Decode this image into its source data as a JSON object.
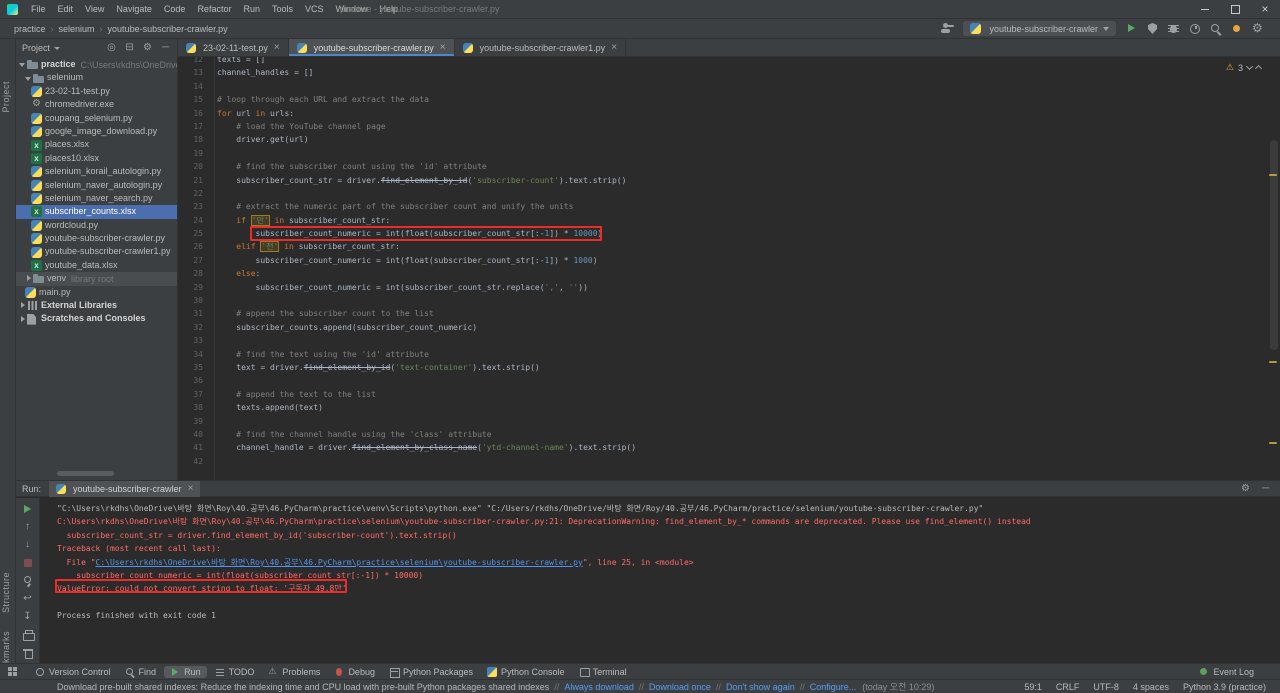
{
  "colors": {
    "panel_bg": "#3c3f41",
    "editor_bg": "#2b2b2b",
    "selection_blue": "#4b6eaf",
    "tab_accent": "#4a88c7",
    "run_green": "#59a869",
    "warning_yellow": "#f0a732",
    "error_red": "#ff6b68",
    "annotation_red": "#ee2b26",
    "link_blue": "#5394ec"
  },
  "titlebar": {
    "menus": [
      "File",
      "Edit",
      "View",
      "Navigate",
      "Code",
      "Refactor",
      "Run",
      "Tools",
      "VCS",
      "Window",
      "Help"
    ],
    "title": "practice - youtube-subscriber-crawler.py"
  },
  "toolbar": {
    "breadcrumbs": [
      "practice",
      "selenium",
      "youtube-subscriber-crawler.py"
    ],
    "run_config": "youtube-subscriber-crawler",
    "actions": [
      "run",
      "coverage",
      "debug",
      "profiler",
      "search",
      "updates",
      "settings"
    ]
  },
  "left_strip": {
    "top": "Project",
    "middle": "Structure",
    "bottom": "Bookmarks"
  },
  "project": {
    "header": "Project",
    "header_icons": [
      "locate",
      "collapse-all",
      "settings",
      "hide"
    ],
    "tree": [
      {
        "label": "practice",
        "suffix": "C:\\Users\\rkdhs\\OneDrive",
        "depth": 0,
        "icon": "folder",
        "chevron": "down"
      },
      {
        "label": "selenium",
        "depth": 1,
        "icon": "folder",
        "chevron": "down"
      },
      {
        "label": "23-02-11-test.py",
        "depth": 2,
        "icon": "python"
      },
      {
        "label": "chromedriver.exe",
        "depth": 2,
        "icon": "exe"
      },
      {
        "label": "coupang_selenium.py",
        "depth": 2,
        "icon": "python"
      },
      {
        "label": "google_image_download.py",
        "depth": 2,
        "icon": "python"
      },
      {
        "label": "places.xlsx",
        "depth": 2,
        "icon": "excel"
      },
      {
        "label": "places10.xlsx",
        "depth": 2,
        "icon": "excel"
      },
      {
        "label": "selenium_korail_autologin.py",
        "depth": 2,
        "icon": "python"
      },
      {
        "label": "selenium_naver_autologin.py",
        "depth": 2,
        "icon": "python"
      },
      {
        "label": "selenium_naver_search.py",
        "depth": 2,
        "icon": "python"
      },
      {
        "label": "subscriber_counts.xlsx",
        "depth": 2,
        "icon": "excel",
        "selected": true
      },
      {
        "label": "wordcloud.py",
        "depth": 2,
        "icon": "python"
      },
      {
        "label": "youtube-subscriber-crawler.py",
        "depth": 2,
        "icon": "python"
      },
      {
        "label": "youtube-subscriber-crawler1.py",
        "depth": 2,
        "icon": "python"
      },
      {
        "label": "youtube_data.xlsx",
        "depth": 2,
        "icon": "excel"
      },
      {
        "label": "venv",
        "suffix": "library root",
        "depth": 1,
        "icon": "folder-special",
        "chevron": "right",
        "hover": true
      },
      {
        "label": "main.py",
        "depth": 1,
        "icon": "python"
      },
      {
        "label": "External Libraries",
        "depth": 0,
        "icon": "libs",
        "chevron": "right"
      },
      {
        "label": "Scratches and Consoles",
        "depth": 0,
        "icon": "scratch",
        "chevron": "right"
      }
    ]
  },
  "editor": {
    "tabs": [
      {
        "label": "23-02-11-test.py"
      },
      {
        "label": "youtube-subscriber-crawler.py",
        "active": true
      },
      {
        "label": "youtube-subscriber-crawler1.py"
      }
    ],
    "inspections": {
      "warnings": "3"
    },
    "code": [
      {
        "n": 12,
        "t": [
          [
            "p",
            "texts = []"
          ]
        ]
      },
      {
        "n": 13,
        "t": [
          [
            "p",
            "channel_handles = []"
          ]
        ]
      },
      {
        "n": 14,
        "t": []
      },
      {
        "n": 15,
        "t": [
          [
            "c",
            "# loop through each URL and extract the data"
          ]
        ]
      },
      {
        "n": 16,
        "t": [
          [
            "k",
            "for"
          ],
          [
            "p",
            " url "
          ],
          [
            "k",
            "in"
          ],
          [
            "p",
            " urls:"
          ]
        ]
      },
      {
        "n": 17,
        "t": [
          [
            "p",
            "    "
          ],
          [
            "c",
            "# load the YouTube channel page"
          ]
        ]
      },
      {
        "n": 18,
        "t": [
          [
            "p",
            "    driver.get(url)"
          ]
        ]
      },
      {
        "n": 19,
        "t": []
      },
      {
        "n": 20,
        "t": [
          [
            "p",
            "    "
          ],
          [
            "c",
            "# find the subscriber count using the 'id' attribute"
          ]
        ]
      },
      {
        "n": 21,
        "t": [
          [
            "p",
            "    subscriber_count_str = driver."
          ],
          [
            "d",
            "find_element_by_id"
          ],
          [
            "p",
            "("
          ],
          [
            "s",
            "'subscriber-count'"
          ],
          [
            "p",
            ").text.strip()"
          ]
        ]
      },
      {
        "n": 22,
        "t": []
      },
      {
        "n": 23,
        "t": [
          [
            "p",
            "    "
          ],
          [
            "c",
            "# extract the numeric part of the subscriber count and unify the units"
          ]
        ]
      },
      {
        "n": 24,
        "t": [
          [
            "p",
            "    "
          ],
          [
            "k",
            "if"
          ],
          [
            "p",
            " "
          ],
          [
            "sh",
            "'만'"
          ],
          [
            "p",
            " "
          ],
          [
            "k",
            "in"
          ],
          [
            "p",
            " subscriber_count_str:"
          ]
        ]
      },
      {
        "n": 25,
        "t": [
          [
            "p",
            "        subscriber_count_numeric = int(float(subscriber_count_str[:-"
          ],
          [
            "n",
            "1"
          ],
          [
            "p",
            "]) * "
          ],
          [
            "n",
            "10000"
          ],
          [
            "p",
            ")"
          ]
        ]
      },
      {
        "n": 26,
        "t": [
          [
            "p",
            "    "
          ],
          [
            "k",
            "elif"
          ],
          [
            "p",
            " "
          ],
          [
            "sh",
            "'천'"
          ],
          [
            "p",
            " "
          ],
          [
            "k",
            "in"
          ],
          [
            "p",
            " subscriber_count_str:"
          ]
        ]
      },
      {
        "n": 27,
        "t": [
          [
            "p",
            "        subscriber_count_numeric = int(float(subscriber_count_str[:-"
          ],
          [
            "n",
            "1"
          ],
          [
            "p",
            "]) * "
          ],
          [
            "n",
            "1000"
          ],
          [
            "p",
            ")"
          ]
        ]
      },
      {
        "n": 28,
        "t": [
          [
            "p",
            "    "
          ],
          [
            "k",
            "else"
          ],
          [
            "p",
            ":"
          ]
        ]
      },
      {
        "n": 29,
        "t": [
          [
            "p",
            "        subscriber_count_numeric = int(subscriber_count_str.replace("
          ],
          [
            "s",
            "','"
          ],
          [
            "p",
            ", "
          ],
          [
            "s",
            "''"
          ],
          [
            "p",
            "))"
          ]
        ]
      },
      {
        "n": 30,
        "t": []
      },
      {
        "n": 31,
        "t": [
          [
            "p",
            "    "
          ],
          [
            "c",
            "# append the subscriber count to the list"
          ]
        ]
      },
      {
        "n": 32,
        "t": [
          [
            "p",
            "    subscriber_counts.append(subscriber_count_numeric)"
          ]
        ]
      },
      {
        "n": 33,
        "t": []
      },
      {
        "n": 34,
        "t": [
          [
            "p",
            "    "
          ],
          [
            "c",
            "# find the text using the 'id' attribute"
          ]
        ]
      },
      {
        "n": 35,
        "t": [
          [
            "p",
            "    text = driver."
          ],
          [
            "d",
            "find_element_by_id"
          ],
          [
            "p",
            "("
          ],
          [
            "s",
            "'text-container'"
          ],
          [
            "p",
            ").text.strip()"
          ]
        ]
      },
      {
        "n": 36,
        "t": []
      },
      {
        "n": 37,
        "t": [
          [
            "p",
            "    "
          ],
          [
            "c",
            "# append the text to the list"
          ]
        ]
      },
      {
        "n": 38,
        "t": [
          [
            "p",
            "    texts.append(text)"
          ]
        ]
      },
      {
        "n": 39,
        "t": []
      },
      {
        "n": 40,
        "t": [
          [
            "p",
            "    "
          ],
          [
            "c",
            "# find the channel handle using the 'class' attribute"
          ]
        ]
      },
      {
        "n": 41,
        "t": [
          [
            "p",
            "    channel_handle = driver."
          ],
          [
            "d",
            "find_element_by_class_name"
          ],
          [
            "p",
            "("
          ],
          [
            "s",
            "'ytd-channel-name'"
          ],
          [
            "p",
            ").text.strip()"
          ]
        ]
      },
      {
        "n": 42,
        "t": []
      }
    ]
  },
  "run_panel": {
    "label": "Run:",
    "tab": "youtube-subscriber-crawler",
    "header_icons": [
      "settings",
      "hide"
    ],
    "toolbar_icons": [
      "rerun",
      "up",
      "down",
      "stop",
      "pin",
      "softwrap",
      "scrollend",
      "print",
      "clear"
    ],
    "console": [
      {
        "t": [
          [
            "cmd",
            "\"C:\\Users\\rkdhs\\OneDrive\\바탕 화면\\Roy\\40.공부\\46.PyCharm\\practice\\venv\\Scripts\\python.exe\" \"C:/Users/rkdhs/OneDrive/바탕 화면/Roy/40.공부/46.PyCharm/practice/selenium/youtube-subscriber-crawler.py\""
          ]
        ]
      },
      {
        "t": [
          [
            "err",
            "C:\\Users\\rkdhs\\OneDrive\\바탕 화면\\Roy\\40.공부\\46.PyCharm\\practice\\selenium\\youtube-subscriber-crawler.py:21: DeprecationWarning: find_element_by_* commands are deprecated. Please use find_element() instead"
          ]
        ]
      },
      {
        "t": [
          [
            "err",
            "  subscriber_count_str = driver.find_element_by_id('subscriber-count').text.strip()"
          ]
        ]
      },
      {
        "t": [
          [
            "err",
            "Traceback (most recent call last):"
          ]
        ]
      },
      {
        "t": [
          [
            "err",
            "  File \""
          ],
          [
            "link",
            "C:\\Users\\rkdhs\\OneDrive\\바탕 화면\\Roy\\40.공부\\46.PyCharm\\practice\\selenium\\youtube-subscriber-crawler.py"
          ],
          [
            "err",
            "\", line 25, in <module>"
          ]
        ]
      },
      {
        "t": [
          [
            "err",
            "    subscriber_count_numeric = int(float(subscriber_count_str[:-1]) * 10000)"
          ]
        ]
      },
      {
        "t": [
          [
            "err",
            "ValueError: could not convert string to float: '구독자 49.8만'"
          ]
        ]
      },
      {
        "t": []
      },
      {
        "t": [
          [
            "cmd",
            "Process finished with exit code 1"
          ]
        ]
      }
    ]
  },
  "bottom_bar": {
    "items": [
      {
        "label": "Version Control",
        "icon": "vc"
      },
      {
        "label": "Find",
        "icon": "find"
      },
      {
        "label": "Run",
        "icon": "run",
        "active": true
      },
      {
        "label": "TODO",
        "icon": "todo"
      },
      {
        "label": "Problems",
        "icon": "problems"
      },
      {
        "label": "Debug",
        "icon": "debug"
      },
      {
        "label": "Python Packages",
        "icon": "pkg"
      },
      {
        "label": "Python Console",
        "icon": "pycon"
      },
      {
        "label": "Terminal",
        "icon": "term"
      }
    ],
    "right_items": [
      {
        "label": "Event Log",
        "icon": "event"
      }
    ]
  },
  "status_bar": {
    "message": "Download pre-built shared indexes: Reduce the indexing time and CPU load with pre-built Python packages shared indexes",
    "links": [
      "Always download",
      "Download once",
      "Don't show again",
      "Configure..."
    ],
    "time": "(today 오전 10:29)",
    "right_items": [
      "59:1",
      "CRLF",
      "UTF-8",
      "4 spaces",
      "Python 3.9 (practice)"
    ]
  }
}
